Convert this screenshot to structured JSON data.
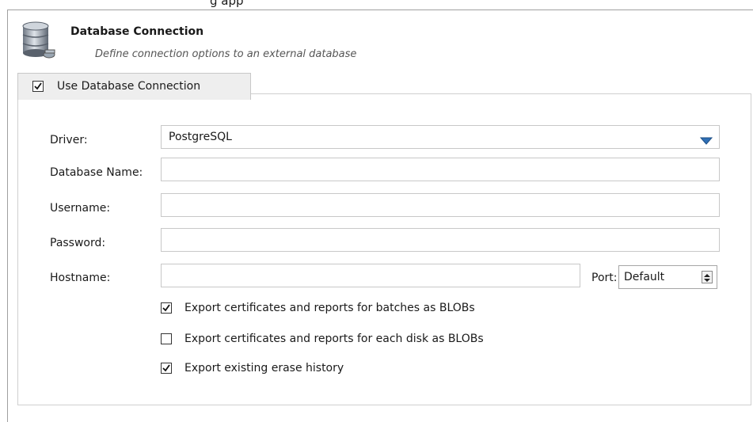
{
  "header": {
    "title": "Database Connection",
    "subtitle": "Define connection options to an external database"
  },
  "group": {
    "checkbox_label": "Use Database Connection",
    "checked": true
  },
  "form": {
    "driver_label": "Driver:",
    "driver_value": "PostgreSQL",
    "dbname_label": "Database Name:",
    "dbname_value": "",
    "username_label": "Username:",
    "username_value": "",
    "password_label": "Password:",
    "password_value": "",
    "hostname_label": "Hostname:",
    "hostname_value": "",
    "port_label": "Port:",
    "port_value": "Default"
  },
  "options": [
    {
      "label": "Export certificates and reports for batches as BLOBs",
      "checked": true
    },
    {
      "label": "Export certificates and reports for each disk as BLOBs",
      "checked": false
    },
    {
      "label": "Export existing erase history",
      "checked": true
    }
  ],
  "colors": {
    "dropdown_arrow": "#2f6fb5",
    "border": "#c8c8c8"
  },
  "icons": {
    "header_icon": "database-icon",
    "dropdown_icon": "triangle-down-icon",
    "spinner_icon": "spinner-updown-icon"
  }
}
